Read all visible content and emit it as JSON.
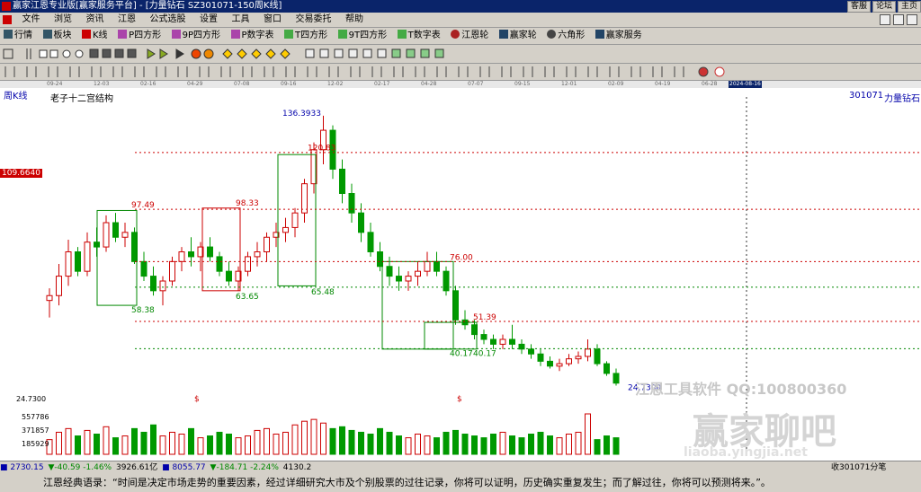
{
  "window": {
    "title": "赢家江恩专业版[赢家服务平台] - [力量钻石 SZ301071-150周K线]",
    "buttons": [
      "客服",
      "论坛",
      "主页"
    ]
  },
  "menu": [
    "文件",
    "浏览",
    "资讯",
    "江恩",
    "公式选股",
    "设置",
    "工具",
    "窗口",
    "交易委托",
    "帮助"
  ],
  "toolbar": [
    "行情",
    "板块",
    "K线",
    "P四方形",
    "9P四方形",
    "P数字表",
    "T四方形",
    "9T四方形",
    "T数字表",
    "江恩轮",
    "赢家轮",
    "六角形",
    "赢家服务"
  ],
  "time_axis": [
    "09-24",
    "12-03",
    "02-16",
    "04-29",
    "07-08",
    "09-16",
    "12-02",
    "02-17",
    "04-28",
    "07-07",
    "09-15",
    "12-01",
    "02-09",
    "04-19",
    "06-28",
    "2024-08-16"
  ],
  "chart": {
    "period_label": "周K线",
    "indicator_name": "老子十二宫结构",
    "symbol_code": "301071",
    "symbol_name": "力量钻石",
    "y_marker": "109.6640",
    "low_label": "24.7300",
    "vol_labels": [
      "557786",
      "371857",
      "185929"
    ],
    "markers": [
      "$",
      "$"
    ],
    "watermark1": "江恩工具软件 QQ:100800360",
    "watermark2": "赢家聊吧",
    "watermark3": "liaoba.yingjia.net"
  },
  "chart_data": {
    "type": "candlestick",
    "title": "老子十二宫结构",
    "symbol": "301071 力量钻石",
    "annotations": {
      "highs": [
        "136.3933",
        "120.83",
        "97.49",
        "98.33",
        "76.00",
        "51.39"
      ],
      "lows": [
        "58.38",
        "63.65",
        "65.48",
        "40.17",
        "40.17",
        "24.7300"
      ]
    },
    "ohlc": [
      [
        60,
        65,
        53,
        62
      ],
      [
        62,
        75,
        58,
        70
      ],
      [
        70,
        85,
        66,
        80
      ],
      [
        80,
        82,
        70,
        72
      ],
      [
        72,
        88,
        70,
        84
      ],
      [
        84,
        90,
        78,
        82
      ],
      [
        82,
        95,
        80,
        92
      ],
      [
        92,
        96,
        84,
        86
      ],
      [
        86,
        92,
        82,
        88
      ],
      [
        88,
        90,
        75,
        76
      ],
      [
        76,
        80,
        68,
        70
      ],
      [
        70,
        74,
        62,
        64
      ],
      [
        64,
        70,
        58,
        68
      ],
      [
        68,
        78,
        66,
        76
      ],
      [
        76,
        82,
        72,
        80
      ],
      [
        80,
        86,
        74,
        78
      ],
      [
        78,
        84,
        72,
        82
      ],
      [
        82,
        86,
        76,
        78
      ],
      [
        78,
        80,
        70,
        72
      ],
      [
        72,
        76,
        66,
        68
      ],
      [
        68,
        74,
        64,
        72
      ],
      [
        72,
        80,
        70,
        78
      ],
      [
        78,
        84,
        74,
        80
      ],
      [
        80,
        88,
        76,
        86
      ],
      [
        86,
        92,
        82,
        88
      ],
      [
        88,
        94,
        84,
        90
      ],
      [
        90,
        98,
        86,
        96
      ],
      [
        96,
        110,
        92,
        108
      ],
      [
        108,
        125,
        104,
        122
      ],
      [
        122,
        136,
        116,
        130
      ],
      [
        130,
        132,
        110,
        114
      ],
      [
        114,
        118,
        100,
        104
      ],
      [
        104,
        108,
        92,
        96
      ],
      [
        96,
        100,
        84,
        88
      ],
      [
        88,
        92,
        78,
        80
      ],
      [
        80,
        84,
        72,
        74
      ],
      [
        74,
        78,
        66,
        70
      ],
      [
        70,
        74,
        64,
        68
      ],
      [
        68,
        72,
        64,
        70
      ],
      [
        70,
        76,
        66,
        72
      ],
      [
        72,
        80,
        70,
        76
      ],
      [
        76,
        80,
        70,
        72
      ],
      [
        72,
        74,
        62,
        64
      ],
      [
        64,
        66,
        50,
        52
      ],
      [
        52,
        56,
        48,
        50
      ],
      [
        50,
        52,
        44,
        46
      ],
      [
        46,
        48,
        42,
        44
      ],
      [
        44,
        46,
        40,
        42
      ],
      [
        42,
        46,
        40,
        44
      ],
      [
        44,
        50,
        40,
        42
      ],
      [
        42,
        44,
        38,
        40
      ],
      [
        40,
        42,
        36,
        38
      ],
      [
        38,
        40,
        33,
        35
      ],
      [
        35,
        37,
        32,
        33
      ],
      [
        33,
        36,
        31,
        34
      ],
      [
        34,
        38,
        33,
        36
      ],
      [
        36,
        39,
        34,
        37
      ],
      [
        37,
        44,
        35,
        40
      ],
      [
        40,
        42,
        33,
        34
      ],
      [
        34,
        35,
        29,
        30
      ],
      [
        30,
        32,
        25,
        26
      ]
    ],
    "volume": [
      40,
      60,
      70,
      50,
      65,
      55,
      75,
      45,
      50,
      70,
      60,
      80,
      50,
      60,
      55,
      70,
      45,
      50,
      60,
      55,
      45,
      50,
      65,
      70,
      55,
      60,
      80,
      90,
      95,
      85,
      70,
      75,
      65,
      60,
      55,
      70,
      60,
      50,
      45,
      55,
      50,
      45,
      60,
      65,
      55,
      50,
      45,
      55,
      60,
      50,
      45,
      55,
      60,
      50,
      45,
      55,
      60,
      110,
      40,
      50,
      45
    ],
    "ylim": [
      20,
      140
    ]
  }
}
